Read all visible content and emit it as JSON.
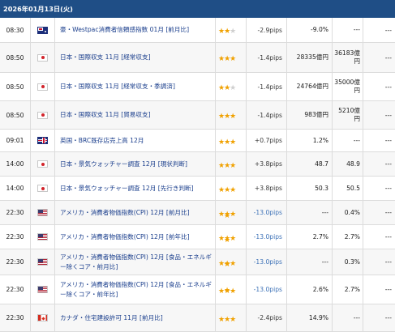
{
  "header": {
    "date": "2026年01月13日(火)"
  },
  "colors": {
    "header_bg": "#1f4e86",
    "star_on": "#f0a100",
    "star_off": "#cfcfcf",
    "link_blue": "#3f73b8"
  },
  "rows": [
    {
      "time": "08:30",
      "flag": "australia-flag",
      "indicator": "豪・Westpac消費者信頼感指数 01月 [前月比]",
      "stars": 2,
      "pips": "-2.9pips",
      "previous": "-9.0%",
      "forecast": "---",
      "actual": "---"
    },
    {
      "time": "08:50",
      "flag": "japan-flag",
      "indicator": "日本・国際収支 11月 [経常収支]",
      "stars": 3,
      "pips": "-1.4pips",
      "previous": "28335億円",
      "forecast": "36183億円",
      "actual": "---"
    },
    {
      "time": "08:50",
      "flag": "japan-flag",
      "indicator": "日本・国際収支 11月 [経常収支・季調済]",
      "stars": 2,
      "pips": "-1.4pips",
      "previous": "24764億円",
      "forecast": "35000億円",
      "actual": "---"
    },
    {
      "time": "08:50",
      "flag": "japan-flag",
      "indicator": "日本・国際収支 11月 [貿易収支]",
      "stars": 3,
      "pips": "-1.4pips",
      "previous": "983億円",
      "forecast": "5210億円",
      "actual": "---"
    },
    {
      "time": "09:01",
      "flag": "uk-flag",
      "indicator": "英国・BRC既存店売上高 12月",
      "stars": 3,
      "pips": "+0.7pips",
      "previous": "1.2%",
      "forecast": "---",
      "actual": "---"
    },
    {
      "time": "14:00",
      "flag": "japan-flag",
      "indicator": "日本・景気ウォッチャー調査 12月 [現状判断]",
      "stars": 3,
      "pips": "+3.8pips",
      "previous": "48.7",
      "forecast": "48.9",
      "actual": "---"
    },
    {
      "time": "14:00",
      "flag": "japan-flag",
      "indicator": "日本・景気ウォッチャー調査 12月 [先行き判断]",
      "stars": 3,
      "pips": "+3.8pips",
      "previous": "50.3",
      "forecast": "50.5",
      "actual": "---"
    },
    {
      "time": "22:30",
      "flag": "usa-flag",
      "indicator": "アメリカ・消費者物価指数(CPI) 12月 [前月比]",
      "stars": 4,
      "pips": "-13.0pips",
      "previous": "---",
      "forecast": "0.4%",
      "actual": "---"
    },
    {
      "time": "22:30",
      "flag": "usa-flag",
      "indicator": "アメリカ・消費者物価指数(CPI) 12月 [前年比]",
      "stars": 4,
      "pips": "-13.0pips",
      "previous": "2.7%",
      "forecast": "2.7%",
      "actual": "---"
    },
    {
      "time": "22:30",
      "flag": "usa-flag",
      "indicator": "アメリカ・消費者物価指数(CPI) 12月 [食品・エネルギー除くコア・前月比]",
      "stars": 4,
      "pips": "-13.0pips",
      "previous": "---",
      "forecast": "0.3%",
      "actual": "---"
    },
    {
      "time": "22:30",
      "flag": "usa-flag",
      "indicator": "アメリカ・消費者物価指数(CPI) 12月 [食品・エネルギー除くコア・前年比]",
      "stars": 4,
      "pips": "-13.0pips",
      "previous": "2.6%",
      "forecast": "2.7%",
      "actual": "---"
    },
    {
      "time": "22:30",
      "flag": "canada-flag",
      "indicator": "カナダ・住宅建設許可 11月 [前月比]",
      "stars": 3,
      "pips": "-2.4pips",
      "previous": "14.9%",
      "forecast": "---",
      "actual": "---"
    }
  ]
}
